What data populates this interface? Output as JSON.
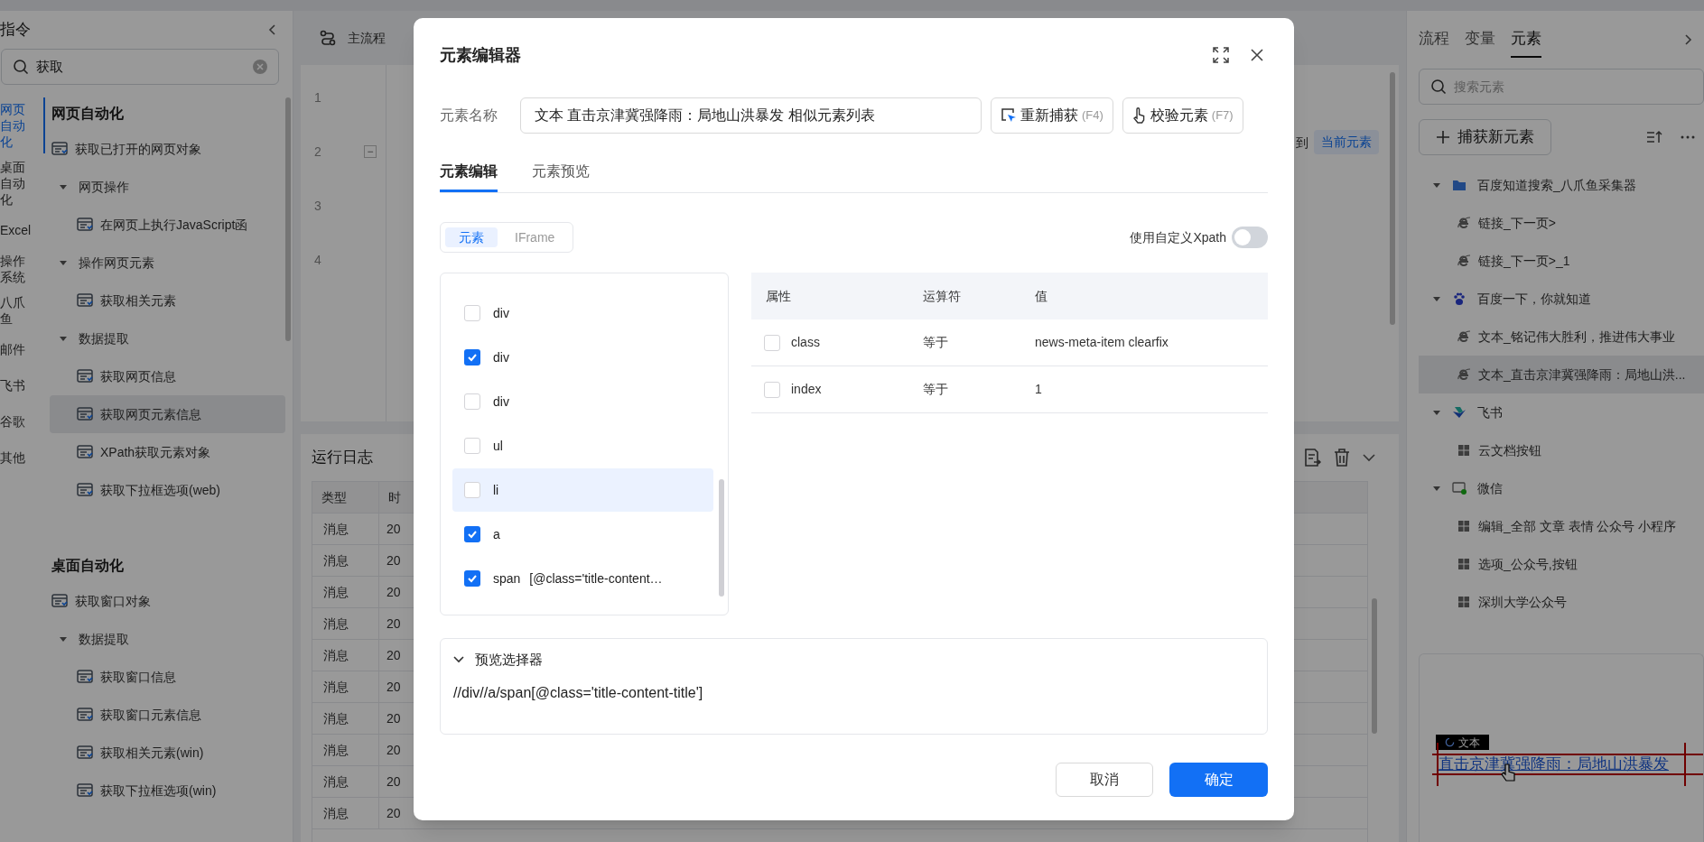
{
  "sidebar": {
    "title": "指令",
    "search": {
      "value": "获取"
    },
    "categories": [
      {
        "label": "网页自动化",
        "selected": true
      },
      {
        "label": "桌面自动化",
        "selected": false
      },
      {
        "label": "Excel",
        "selected": false
      },
      {
        "label": "操作系统",
        "selected": false
      },
      {
        "label": "八爪鱼",
        "selected": false
      },
      {
        "label": "邮件",
        "selected": false
      },
      {
        "label": "飞书",
        "selected": false
      },
      {
        "label": "谷歌",
        "selected": false
      },
      {
        "label": "其他",
        "selected": false
      }
    ],
    "sections": [
      {
        "title": "网页自动化",
        "items": [
          {
            "kind": "leaf",
            "label": "获取已打开的网页对象",
            "selected": false
          },
          {
            "kind": "group",
            "label": "网页操作",
            "expanded": true,
            "children": [
              {
                "label": "在网页上执行JavaScript函",
                "selected": false
              }
            ]
          },
          {
            "kind": "group",
            "label": "操作网页元素",
            "expanded": true,
            "children": [
              {
                "label": "获取相关元素",
                "selected": false
              }
            ]
          },
          {
            "kind": "group",
            "label": "数据提取",
            "expanded": true,
            "children": [
              {
                "label": "获取网页信息",
                "selected": false
              },
              {
                "label": "获取网页元素信息",
                "selected": true
              },
              {
                "label": "XPath获取元素对象",
                "selected": false
              },
              {
                "label": "获取下拉框选项(web)",
                "selected": false
              }
            ]
          }
        ]
      },
      {
        "title": "桌面自动化",
        "items": [
          {
            "kind": "leaf",
            "label": "获取窗口对象",
            "selected": false
          },
          {
            "kind": "group",
            "label": "数据提取",
            "expanded": true,
            "children": [
              {
                "label": "获取窗口信息",
                "selected": false
              },
              {
                "label": "获取窗口元素信息",
                "selected": false
              },
              {
                "label": "获取相关元素(win)",
                "selected": false
              },
              {
                "label": "获取下拉框选项(win)",
                "selected": false
              }
            ]
          }
        ]
      }
    ]
  },
  "flow": {
    "tab": "主流程",
    "lines": [
      {
        "number": "1"
      },
      {
        "number": "2",
        "toggle": "−"
      },
      {
        "number": "3"
      },
      {
        "number": "4"
      }
    ],
    "side_text": "到",
    "side_tag": "当前元素"
  },
  "log": {
    "title": "运行日志",
    "columns": [
      "类型",
      "时"
    ],
    "rows": [
      [
        "消息",
        "20"
      ],
      [
        "消息",
        "20"
      ],
      [
        "消息",
        "20"
      ],
      [
        "消息",
        "20"
      ],
      [
        "消息",
        "20"
      ],
      [
        "消息",
        "20"
      ],
      [
        "消息",
        "20"
      ],
      [
        "消息",
        "20"
      ],
      [
        "消息",
        "20"
      ],
      [
        "消息",
        "20"
      ]
    ]
  },
  "modal": {
    "title": "元素编辑器",
    "name_label": "元素名称",
    "name_value": "文本 直击京津冀强降雨：局地山洪暴发 相似元素列表",
    "recapture": {
      "label": "重新捕获",
      "shortcut": "(F4)"
    },
    "verify": {
      "label": "校验元素",
      "shortcut": "(F7)"
    },
    "tabs": [
      {
        "label": "元素编辑",
        "selected": true
      },
      {
        "label": "元素预览",
        "selected": false
      }
    ],
    "modes": [
      {
        "label": "元素",
        "selected": true
      },
      {
        "label": "IFrame",
        "selected": false
      }
    ],
    "xpath_toggle": {
      "label": "使用自定义Xpath",
      "on": false
    },
    "nodes": [
      {
        "label": "div",
        "checked": false,
        "selected": false
      },
      {
        "label": "div",
        "checked": true,
        "selected": false
      },
      {
        "label": "div",
        "checked": false,
        "selected": false
      },
      {
        "label": "ul",
        "checked": false,
        "selected": false
      },
      {
        "label": "li",
        "checked": false,
        "selected": true
      },
      {
        "label": "a",
        "checked": true,
        "selected": false
      },
      {
        "label": "span",
        "predicate": "[@class='title-content…",
        "checked": true,
        "selected": false
      }
    ],
    "attributes": {
      "columns": [
        "属性",
        "运算符",
        "值"
      ],
      "rows": [
        {
          "checked": false,
          "name": "class",
          "operator": "等于",
          "value": "news-meta-item clearfix"
        },
        {
          "checked": false,
          "name": "index",
          "operator": "等于",
          "value": "1"
        }
      ]
    },
    "preview": {
      "label": "预览选择器",
      "expanded": true,
      "xpath": "//div//a/span[@class='title-content-title']"
    },
    "cancel": "取消",
    "confirm": "确定"
  },
  "right": {
    "tabs": [
      {
        "label": "流程",
        "selected": false
      },
      {
        "label": "变量",
        "selected": false
      },
      {
        "label": "元素",
        "selected": true
      }
    ],
    "search": {
      "placeholder": "搜索元素"
    },
    "capture": "捕获新元素",
    "groups": [
      {
        "kind": "folder",
        "label": "百度知道搜索_八爪鱼采集器",
        "expanded": true,
        "children": [
          {
            "kind": "web",
            "label": "链接_下一页>",
            "selected": false
          },
          {
            "kind": "web",
            "label": "链接_下一页>_1",
            "selected": false
          }
        ]
      },
      {
        "kind": "paw",
        "label": "百度一下，你就知道",
        "expanded": true,
        "children": [
          {
            "kind": "web",
            "label": "文本_铭记伟大胜利，推进伟大事业",
            "selected": false
          },
          {
            "kind": "web",
            "label": "文本_直击京津冀强降雨：局地山洪...",
            "selected": true
          }
        ]
      },
      {
        "kind": "bird",
        "label": "飞书",
        "expanded": true,
        "children": [
          {
            "kind": "desktop",
            "label": "云文档按钮",
            "selected": false
          }
        ]
      },
      {
        "kind": "chat",
        "label": "微信",
        "expanded": true,
        "children": [
          {
            "kind": "desktop",
            "label": "编辑_全部 文章 表情 公众号 小程序",
            "selected": false
          },
          {
            "kind": "desktop",
            "label": "选项_公众号,按钮",
            "selected": false
          },
          {
            "kind": "desktop",
            "label": "深圳大学公众号",
            "selected": false
          }
        ]
      }
    ],
    "preview": {
      "tag": "文本",
      "text": "直击京津冀强降雨：局地山洪暴发"
    }
  }
}
